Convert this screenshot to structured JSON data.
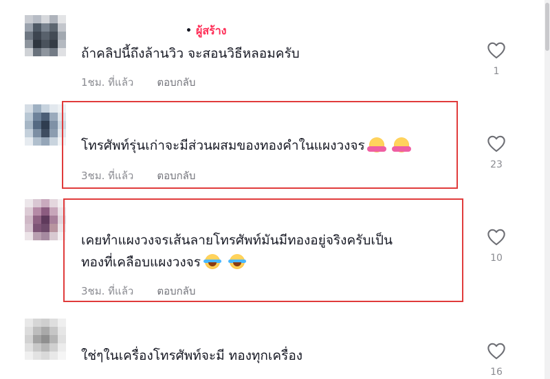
{
  "comments": [
    {
      "author": "",
      "creator_badge": "ผู้สร้าง",
      "text": "ถ้าคลิปนี้ถึงล้านวิว จะสอนวิธีหลอมครับ",
      "time": "1ชม. ที่แล้ว",
      "reply": "ตอบกลับ",
      "likes": "1",
      "emoji": []
    },
    {
      "author": "",
      "text": "โทรศัพท์รุ่นเก่าจะมีส่วนผสมของทองคำในแผงวงจร",
      "time": "3ชม. ที่แล้ว",
      "reply": "ตอบกลับ",
      "likes": "23",
      "emoji": [
        "smiling-face-with-hearts-emoji",
        "smiling-face-with-hearts-emoji"
      ]
    },
    {
      "author": "",
      "text_line1": "เคยทำแผงวงจรเส้นลายโทรศัพท์มันมีทองอยู่จริงครับเป็น",
      "text_line2": "ทองที่เคลือบแผงวงจร",
      "time": "3ชม. ที่แล้ว",
      "reply": "ตอบกลับ",
      "likes": "10",
      "emoji": [
        "face-with-tears-of-joy-emoji",
        "face-with-tears-of-joy-emoji"
      ]
    },
    {
      "author": "",
      "text": "ใช่ๆในเครื่องโทรศัพท์จะมี ทองทุกเครื่อง",
      "likes": "16"
    }
  ],
  "icons": {
    "like": "heart-outline-icon"
  },
  "colors": {
    "highlight": "#e03a3a",
    "creator": "#fe2c55",
    "muted": "#8a8b91"
  }
}
